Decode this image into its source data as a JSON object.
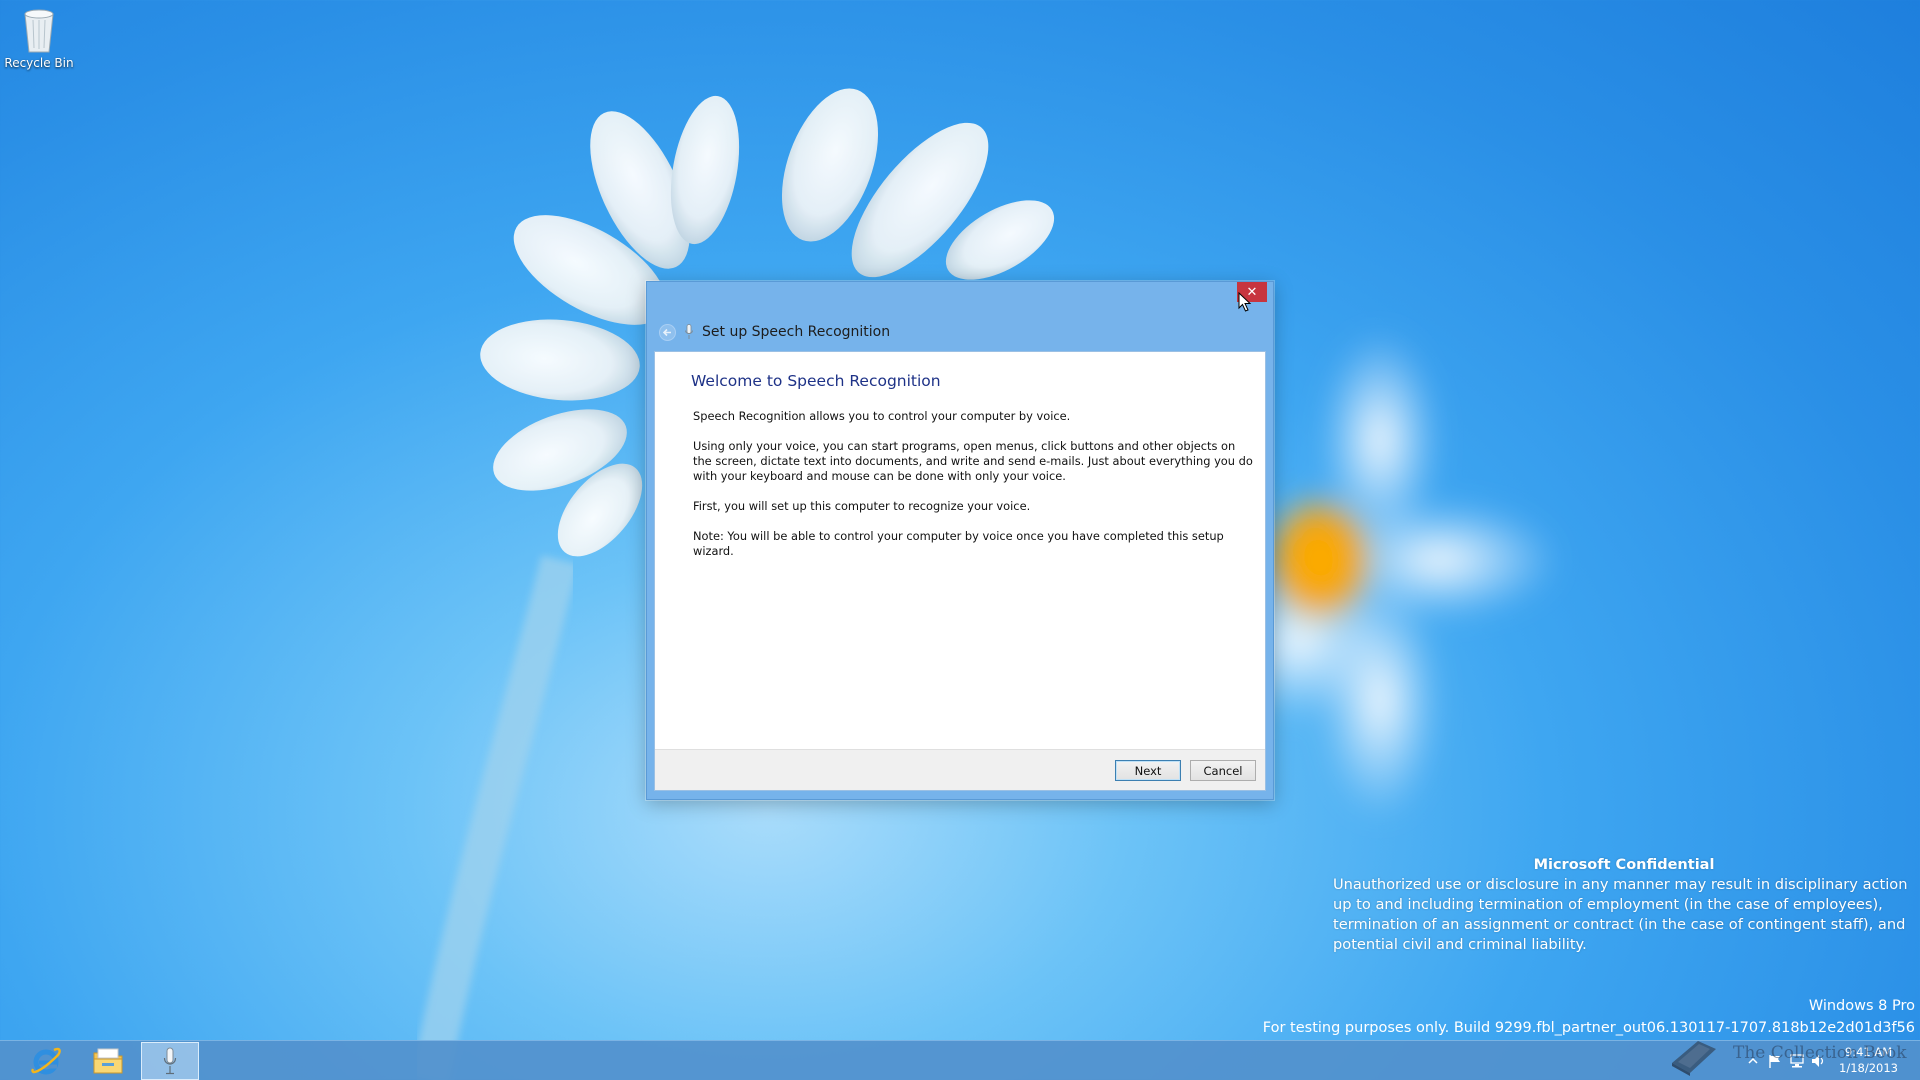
{
  "desktop": {
    "icons": [
      {
        "label": "Recycle Bin",
        "icon": "recycle-bin-icon"
      }
    ]
  },
  "dialog": {
    "title": "Set up Speech Recognition",
    "close_glyph": "✕",
    "heading": "Welcome to Speech Recognition",
    "paragraphs": [
      "Speech Recognition allows you to control your computer by voice.",
      "Using only your voice, you can start programs, open menus, click buttons and other objects on the screen, dictate text into documents, and write and send e-mails. Just about everything you do with your keyboard and mouse can be done with only your voice.",
      "First, you will set up this computer to recognize your voice.",
      "Note: You will be able to control your computer by voice once you have completed this setup wizard."
    ],
    "buttons": {
      "next": "Next",
      "cancel": "Cancel"
    }
  },
  "watermark": {
    "confidential_title": "Microsoft Confidential",
    "confidential_text": "Unauthorized use or disclosure in any manner may result in disciplinary action up to and including termination of employment (in the case of employees), termination of an assignment or contract (in the case of contingent staff), and potential civil and criminal liability.",
    "edition": "Windows 8 Pro",
    "build": "For testing purposes only. Build 9299.fbl_partner_out06.130117-1707.818b12e2d01d3f56",
    "logo_text": "The Collection Book"
  },
  "taskbar": {
    "pinned": [
      {
        "name": "Internet Explorer",
        "icon": "internet-explorer-icon"
      },
      {
        "name": "File Explorer",
        "icon": "file-explorer-icon"
      },
      {
        "name": "Speech Recognition",
        "icon": "microphone-icon"
      }
    ],
    "clock": {
      "time": "9:41 AM",
      "date": "1/18/2013"
    }
  },
  "colors": {
    "window_frame": "#76b3eb",
    "close_button": "#c7353f",
    "heading_text": "#1e3287",
    "taskbar": "#5291cd"
  }
}
